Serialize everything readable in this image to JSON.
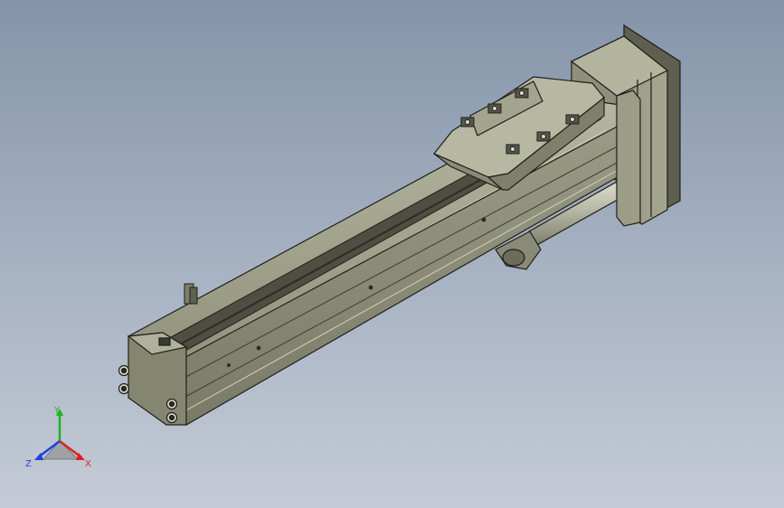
{
  "viewport": {
    "background_top": "#8594a9",
    "background_bottom": "#c4cbd6"
  },
  "model": {
    "body_color": "#9e9f89",
    "shade_color": "#6d6e5c",
    "edge_color": "#1e1f1a",
    "icon": "linear-actuator-model"
  },
  "triad": {
    "icon": "view-orientation-triad",
    "x_label": "X",
    "y_label": "Y",
    "z_label": "Z",
    "x_color": "#e02020",
    "y_color": "#20b020",
    "z_color": "#2040e0"
  }
}
